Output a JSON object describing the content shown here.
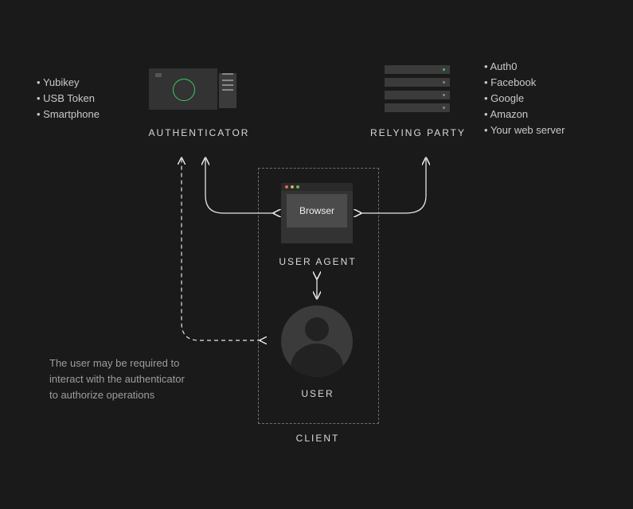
{
  "authenticator": {
    "label": "AUTHENTICATOR",
    "examples": [
      "Yubikey",
      "USB Token",
      "Smartphone"
    ]
  },
  "relying_party": {
    "label": "RELYING PARTY",
    "examples": [
      "Auth0",
      "Facebook",
      "Google",
      "Amazon",
      "Your web server"
    ]
  },
  "client": {
    "label": "CLIENT",
    "user_agent_label": "USER AGENT",
    "browser_label": "Browser",
    "user_label": "USER"
  },
  "note": {
    "line1": "The user may be required to",
    "line2": "interact with the authenticator",
    "line3": "to authorize operations"
  }
}
